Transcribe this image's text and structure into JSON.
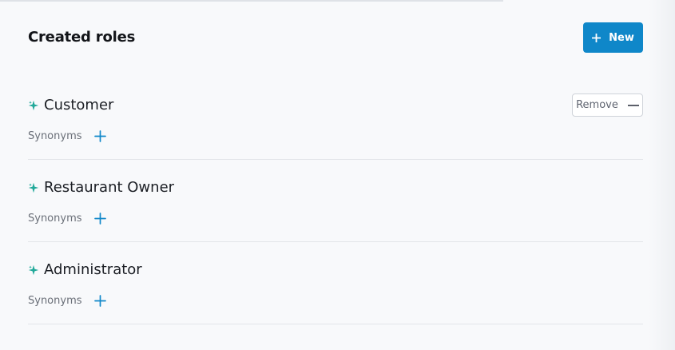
{
  "header": {
    "title": "Created roles",
    "new_button_label": "New"
  },
  "roles": [
    {
      "name": "Customer",
      "synonyms_label": "Synonyms",
      "remove_label": "Remove"
    },
    {
      "name": "Restaurant Owner",
      "synonyms_label": "Synonyms"
    },
    {
      "name": "Administrator",
      "synonyms_label": "Synonyms"
    }
  ],
  "icons": {
    "new": "plus-icon",
    "role": "sparkle-icon",
    "add_synonym": "plus-icon",
    "remove": "minus-icon"
  },
  "colors": {
    "accent": "#0f87c9",
    "role_icon": "#22a99a",
    "background": "#f8f9fb"
  }
}
